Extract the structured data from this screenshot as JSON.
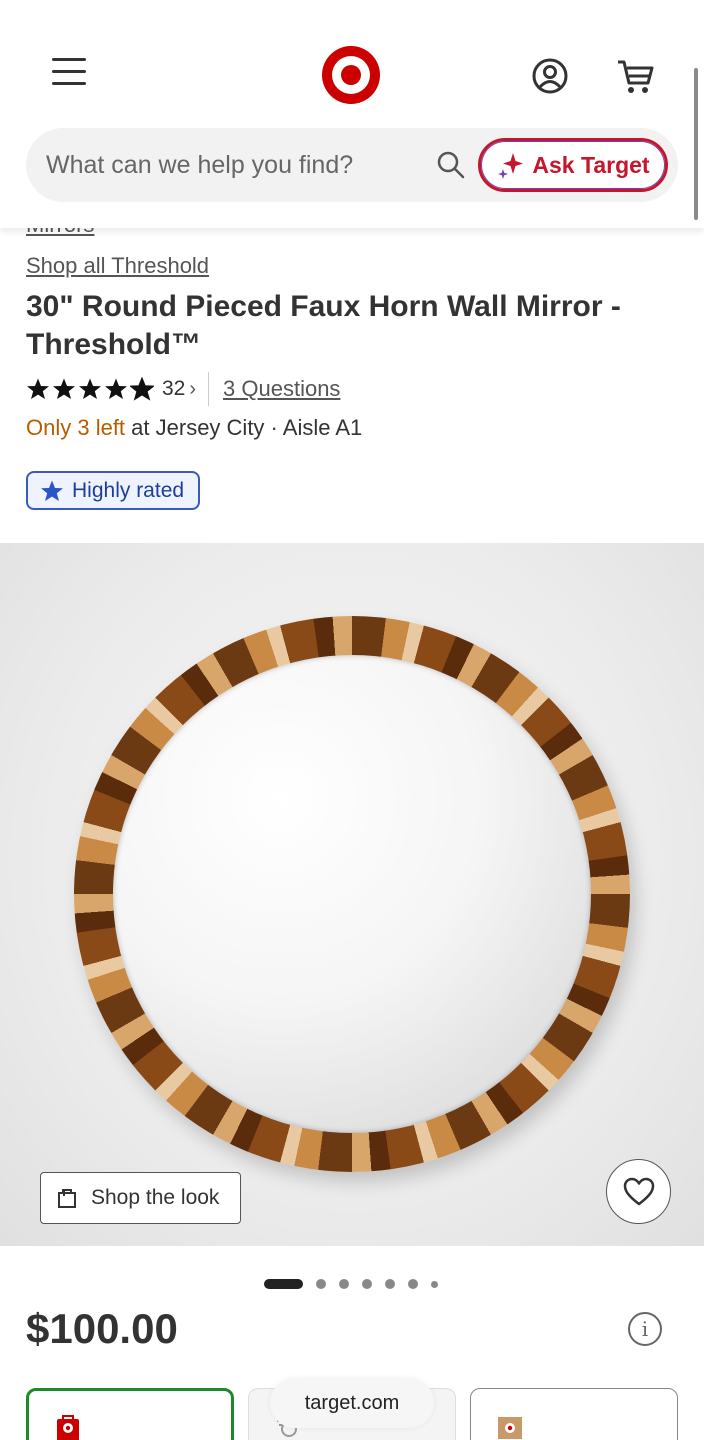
{
  "header": {
    "search_placeholder": "What can we help you find?",
    "ask_label": "Ask Target"
  },
  "breadcrumb": {
    "partial": "Mirrors"
  },
  "product": {
    "brand_link": "Shop all Threshold",
    "title": "30\" Round Pieced Faux Horn Wall Mirror - Threshold™",
    "rating": 4.8,
    "rating_count": "32",
    "questions": "3 Questions",
    "stock_left": "Only 3 left",
    "stock_location": "at Jersey City · Aisle A1",
    "badge": "Highly rated",
    "price": "$100.00"
  },
  "gallery": {
    "shop_look_label": "Shop the look",
    "dots_total": 7,
    "active_dot": 1
  },
  "footer": {
    "url": "target.com"
  },
  "colors": {
    "brand_red": "#cc0000",
    "stock_orange": "#b85c00",
    "badge_blue": "#1d3d9a",
    "selected_green": "#1a8a2a"
  },
  "icons": [
    "menu-icon",
    "target-logo",
    "account-icon",
    "cart-icon",
    "search-icon",
    "sparkle-icon",
    "star-icon",
    "shopping-bag-icon",
    "heart-icon",
    "info-icon",
    "store-icon",
    "delivery-icon",
    "shipping-icon"
  ]
}
